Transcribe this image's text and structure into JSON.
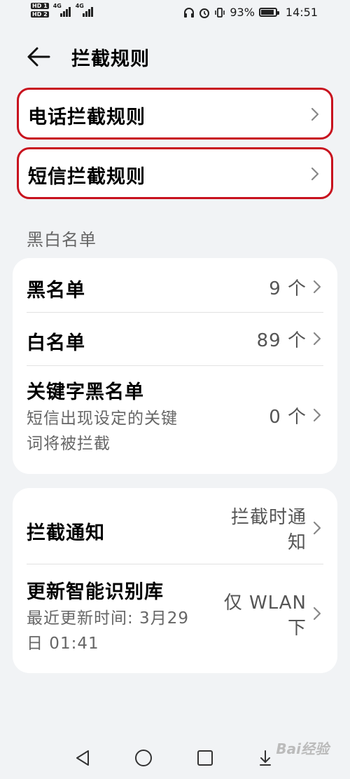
{
  "status_bar": {
    "hd1": "HD 1",
    "hd2": "HD 2",
    "net1": "4G",
    "net2": "4G",
    "battery_percent": "93%",
    "time": "14:51"
  },
  "header": {
    "title": "拦截规则"
  },
  "rules": {
    "call_rules_label": "电话拦截规则",
    "sms_rules_label": "短信拦截规则"
  },
  "lists_section": {
    "label": "黑白名单",
    "blacklist": {
      "title": "黑名单",
      "value": "9 个"
    },
    "whitelist": {
      "title": "白名单",
      "value": "89 个"
    },
    "keyword_blacklist": {
      "title": "关键字黑名单",
      "subtitle_line1": "短信出现设定的关键",
      "subtitle_line2": "词将被拦截",
      "value": "0 个"
    }
  },
  "settings": {
    "notify": {
      "title": "拦截通知",
      "value_line1": "拦截时通",
      "value_line2": "知"
    },
    "update_lib": {
      "title": "更新智能识别库",
      "subtitle_line1": "最近更新时间: 3月29",
      "subtitle_line2": "日 01:41",
      "value_line1": "仅 WLAN",
      "value_line2": "下"
    }
  },
  "watermark": "Bai经验",
  "icons": {
    "back": "back-arrow-icon",
    "chevron": "chevron-right-icon",
    "nav_back": "triangle-back-icon",
    "nav_home": "circle-home-icon",
    "nav_recent": "square-recent-icon",
    "nav_down": "swipe-down-icon"
  },
  "colors": {
    "highlight_border": "#c8121e",
    "background": "#f1f3f5",
    "card": "#ffffff"
  }
}
